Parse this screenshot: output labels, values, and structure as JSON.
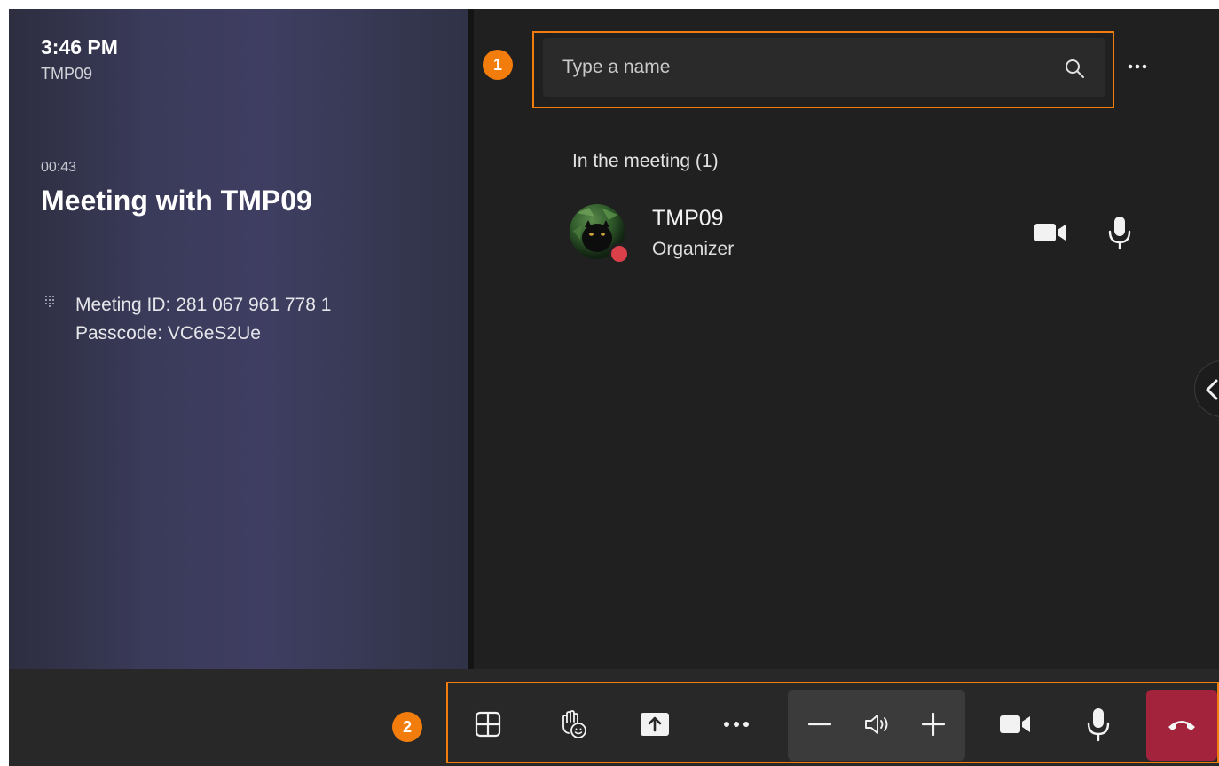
{
  "left_panel": {
    "clock": "3:46 PM",
    "device_name": "TMP09",
    "elapsed": "00:43",
    "meeting_title": "Meeting with TMP09",
    "meeting_id": "Meeting ID:  281 067 961 778 1",
    "passcode": "Passcode: VC6eS2Ue"
  },
  "annotations": {
    "badge_1": "1",
    "badge_2": "2",
    "highlight_color": "#f27d0c"
  },
  "search": {
    "placeholder": "Type a name",
    "value": "",
    "icon": "search-icon"
  },
  "participants": {
    "section_header": "In the meeting (1)",
    "items": [
      {
        "name": "TMP09",
        "role": "Organizer",
        "status_color": "#d9404a",
        "actions": [
          "video-camera-icon",
          "microphone-icon"
        ]
      }
    ]
  },
  "toolbar": {
    "buttons": [
      "layout-grid-icon",
      "raise-hand-react-icon",
      "share-screen-icon",
      "more-options-icon",
      "volume-down-icon",
      "speaker-icon",
      "volume-up-icon",
      "video-camera-icon",
      "microphone-icon",
      "hang-up-icon"
    ],
    "hangup_color": "#a3223c"
  }
}
